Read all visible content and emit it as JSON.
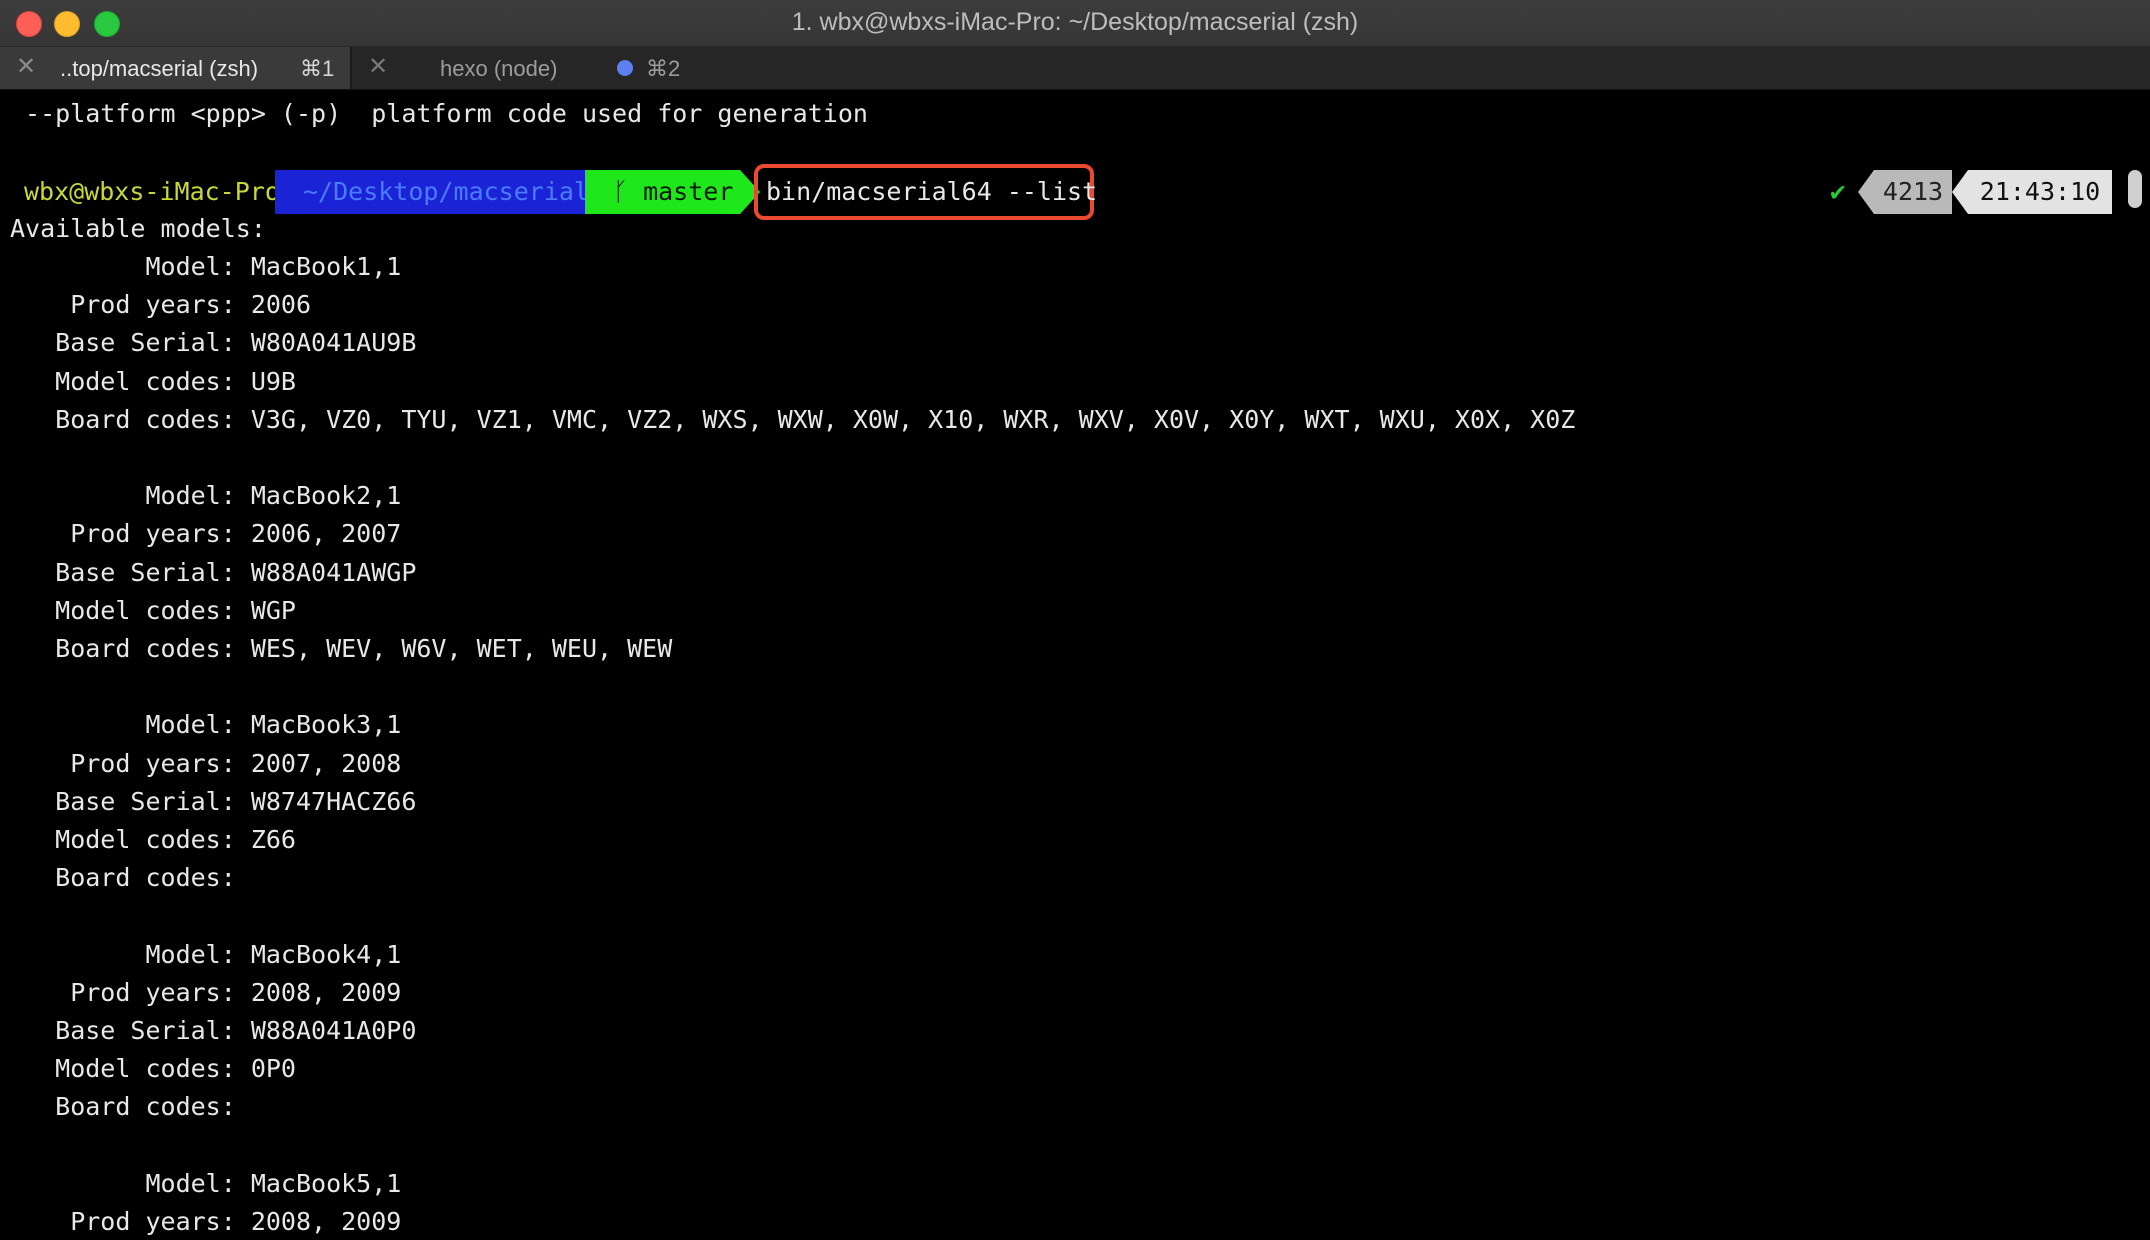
{
  "window": {
    "title": "1. wbx@wbxs-iMac-Pro: ~/Desktop/macserial (zsh)"
  },
  "tabs": [
    {
      "label": "..top/macserial (zsh)",
      "shortcut": "⌘1",
      "active": true
    },
    {
      "label": "hexo (node)",
      "shortcut": "⌘2",
      "active": false
    }
  ],
  "terminal": {
    "prev_line": " --platform <ppp> (-p)  platform code used for generation",
    "prompt": {
      "user": "wbx@wbxs-iMac-Pro",
      "path": "~/Desktop/macserial",
      "branch": "master",
      "command": "bin/macserial64 --list",
      "status_check": "✔",
      "history_count": "4213",
      "time": "21:43:10"
    },
    "heading": "Available models:",
    "lines": [
      "         Model: MacBook1,1",
      "    Prod years: 2006",
      "   Base Serial: W80A041AU9B",
      "   Model codes: U9B",
      "   Board codes: V3G, VZ0, TYU, VZ1, VMC, VZ2, WXS, WXW, X0W, X10, WXR, WXV, X0V, X0Y, WXT, WXU, X0X, X0Z",
      "",
      "         Model: MacBook2,1",
      "    Prod years: 2006, 2007",
      "   Base Serial: W88A041AWGP",
      "   Model codes: WGP",
      "   Board codes: WES, WEV, W6V, WET, WEU, WEW",
      "",
      "         Model: MacBook3,1",
      "    Prod years: 2007, 2008",
      "   Base Serial: W8747HACZ66",
      "   Model codes: Z66",
      "   Board codes:",
      "",
      "         Model: MacBook4,1",
      "    Prod years: 2008, 2009",
      "   Base Serial: W88A041A0P0",
      "   Model codes: 0P0",
      "   Board codes:",
      "",
      "         Model: MacBook5,1",
      "    Prod years: 2008, 2009"
    ]
  },
  "colors": {
    "path_segment": "#1a23d6",
    "branch_segment": "#1ee81a",
    "highlight_box": "#ea4a2f",
    "user_text": "#c9d837"
  }
}
